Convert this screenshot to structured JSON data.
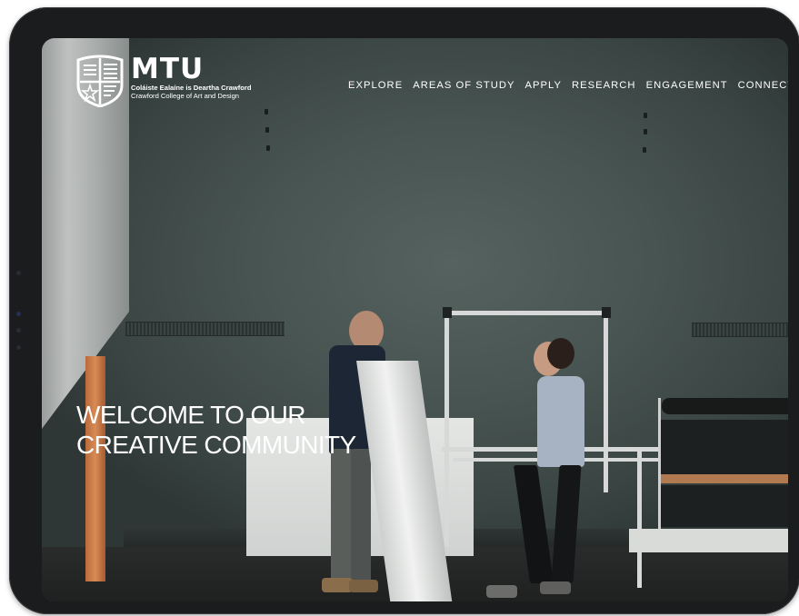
{
  "brand": {
    "name": "MTU",
    "subtitle_irish": "Coláiste Ealaíne is Deartha Crawford",
    "subtitle_english": "Crawford College of Art and Design"
  },
  "nav": {
    "items": [
      {
        "label": "EXPLORE"
      },
      {
        "label": "AREAS OF STUDY"
      },
      {
        "label": "APPLY"
      },
      {
        "label": "RESEARCH"
      },
      {
        "label": "ENGAGEMENT"
      },
      {
        "label": "CONNECT"
      }
    ]
  },
  "hero": {
    "headline_line1": "WELCOME TO OUR",
    "headline_line2": "CREATIVE COMMUNITY",
    "background": "studio-photo-two-artists"
  },
  "icons": {
    "logo": "mtu-crest-icon"
  },
  "colors": {
    "text": "#ffffff",
    "device_frame": "#1b1c1e",
    "wall": "#485451"
  }
}
